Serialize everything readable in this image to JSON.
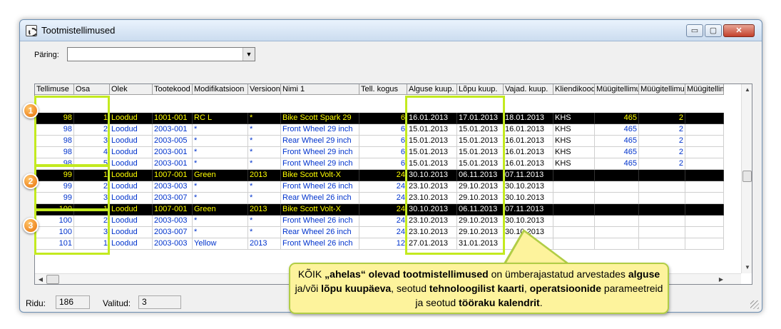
{
  "window": {
    "title": "Tootmistellimused",
    "app_icon": "gear-window-icon",
    "controls": {
      "minimize": "▭",
      "maximize": "▢",
      "close": "✕"
    }
  },
  "query": {
    "label": "Päring:",
    "value": ""
  },
  "grid": {
    "columns": [
      "Tellimuse",
      "Osa",
      "Olek",
      "Tootekood",
      "Modifikatsioon",
      "Versioon",
      "Nimi 1",
      "Tell. kogus",
      "Alguse kuup.",
      "Lõpu kuup.",
      "Vajad. kuup.",
      "Kliendikood",
      "Müügitellimus",
      "Müügitellimus",
      "Müügitellim"
    ],
    "rows": [
      {
        "hl": true,
        "cells": [
          "98",
          "1",
          "Loodud",
          "1001-001",
          "RC L",
          "*",
          "Bike Scott Spark 29",
          "6",
          "16.01.2013",
          "17.01.2013",
          "18.01.2013",
          "KHS",
          "465",
          "2",
          ""
        ]
      },
      {
        "hl": false,
        "cells": [
          "98",
          "2",
          "Loodud",
          "2003-001",
          "*",
          "*",
          "Front Wheel 29 inch",
          "6",
          "15.01.2013",
          "15.01.2013",
          "16.01.2013",
          "KHS",
          "465",
          "2",
          ""
        ]
      },
      {
        "hl": false,
        "cells": [
          "98",
          "3",
          "Loodud",
          "2003-005",
          "*",
          "*",
          "Rear Wheel 29 inch",
          "6",
          "15.01.2013",
          "15.01.2013",
          "16.01.2013",
          "KHS",
          "465",
          "2",
          ""
        ]
      },
      {
        "hl": false,
        "cells": [
          "98",
          "4",
          "Loodud",
          "2003-001",
          "*",
          "*",
          "Front Wheel 29 inch",
          "6",
          "15.01.2013",
          "15.01.2013",
          "16.01.2013",
          "KHS",
          "465",
          "2",
          ""
        ]
      },
      {
        "hl": false,
        "cells": [
          "98",
          "5",
          "Loodud",
          "2003-001",
          "*",
          "*",
          "Front Wheel 29 inch",
          "6",
          "15.01.2013",
          "15.01.2013",
          "16.01.2013",
          "KHS",
          "465",
          "2",
          ""
        ]
      },
      {
        "hl": true,
        "cells": [
          "99",
          "1",
          "Loodud",
          "1007-001",
          "Green",
          "2013",
          "Bike Scott Volt-X",
          "24",
          "30.10.2013",
          "06.11.2013",
          "07.11.2013",
          "",
          "",
          "",
          ""
        ]
      },
      {
        "hl": false,
        "cells": [
          "99",
          "2",
          "Loodud",
          "2003-003",
          "*",
          "*",
          "Front Wheel 26 inch",
          "24",
          "23.10.2013",
          "29.10.2013",
          "30.10.2013",
          "",
          "",
          "",
          ""
        ]
      },
      {
        "hl": false,
        "cells": [
          "99",
          "3",
          "Loodud",
          "2003-007",
          "*",
          "*",
          "Rear Wheel 26 inch",
          "24",
          "23.10.2013",
          "29.10.2013",
          "30.10.2013",
          "",
          "",
          "",
          ""
        ]
      },
      {
        "hl": true,
        "cells": [
          "100",
          "1",
          "Loodud",
          "1007-001",
          "Green",
          "2013",
          "Bike Scott Volt-X",
          "24",
          "30.10.2013",
          "06.11.2013",
          "07.11.2013",
          "",
          "",
          "",
          ""
        ]
      },
      {
        "hl": false,
        "cells": [
          "100",
          "2",
          "Loodud",
          "2003-003",
          "*",
          "*",
          "Front Wheel 26 inch",
          "24",
          "23.10.2013",
          "29.10.2013",
          "30.10.2013",
          "",
          "",
          "",
          ""
        ]
      },
      {
        "hl": false,
        "cells": [
          "100",
          "3",
          "Loodud",
          "2003-007",
          "*",
          "*",
          "Rear Wheel 26 inch",
          "24",
          "23.10.2013",
          "29.10.2013",
          "30.10.2013",
          "",
          "",
          "",
          ""
        ]
      },
      {
        "hl": false,
        "cells": [
          "101",
          "1",
          "Loodud",
          "2003-003",
          "Yellow",
          "2013",
          "Front Wheel 26 inch",
          "12",
          "27.01.2013",
          "31.01.2013",
          "",
          "",
          "",
          "",
          ""
        ]
      }
    ]
  },
  "markers": [
    "1",
    "2",
    "3"
  ],
  "status": {
    "rows_label": "Ridu:",
    "rows_value": "186",
    "selected_label": "Valitud:",
    "selected_value": "3"
  },
  "callout": {
    "p1": "KÕIK ",
    "b1": "„ahelas“ olevad tootmistellimused",
    "p2": " on ümberajastatud arvestades ",
    "b2": "alguse",
    "p3": " ja/või ",
    "b3": "lõpu kuupäeva",
    "p4": ", seotud ",
    "b4": "tehnoloogilist kaarti",
    "p5": ", ",
    "b5": "operatsioonide",
    "p6": " parameetreid ja seotud ",
    "b6": "tööraku kalendrit",
    "p7": "."
  },
  "colors": {
    "highlight_bg": "#000000",
    "highlight_text": "#ffff00",
    "link_text": "#0033cc",
    "frame": "#c3ea1f",
    "callout_bg": "#fdf39c"
  }
}
